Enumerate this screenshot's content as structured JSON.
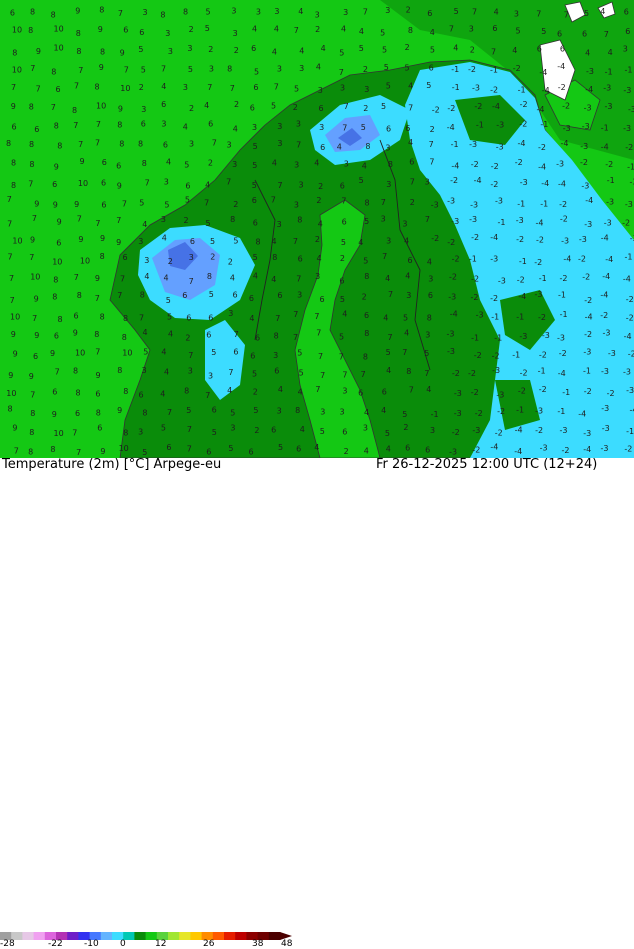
{
  "map": {
    "colors": {
      "sea_warm": "#14c814",
      "sea_cool": "#0fa50f",
      "land_cool": "#0a8c0a",
      "land_cold": "#3cdcff",
      "land_frost": "#64a0ff",
      "land_deep_frost": "#4672e6",
      "coastline": "#333333",
      "border": "#222222",
      "value_text": "#1e1e1e"
    }
  },
  "footer": {
    "title": "Temperature (2m) [°C] Arpege-eu",
    "datetime": "Fr 26-12-2025 12:00 UTC (12+24)"
  },
  "colorbar": {
    "ticks": [
      "-28",
      "-22",
      "-10",
      "0",
      "12",
      "26",
      "38",
      "48"
    ],
    "colors": [
      "#a0a0a0",
      "#c8c8c8",
      "#e6c8e6",
      "#f0a0f0",
      "#dc64dc",
      "#b432b4",
      "#6e1ec8",
      "#3232f0",
      "#4678ff",
      "#64b4ff",
      "#3cdcff",
      "#00c8b4",
      "#0a8c0a",
      "#14c814",
      "#5ad23c",
      "#a0e632",
      "#e6e628",
      "#ffc800",
      "#ff8c00",
      "#ff5a00",
      "#e61e00",
      "#be0000",
      "#8c0000",
      "#6e0000",
      "#4b0000"
    ]
  }
}
